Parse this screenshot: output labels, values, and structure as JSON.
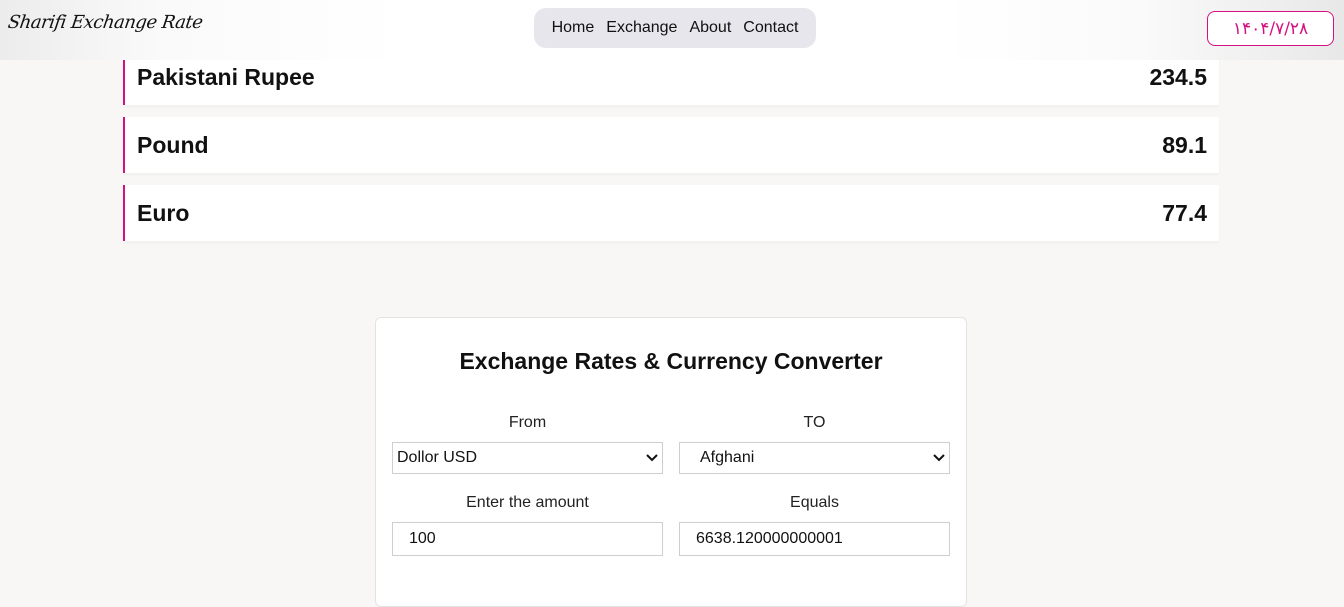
{
  "header": {
    "logo": "Sharifi Exchange Rate",
    "nav": [
      "Home",
      "Exchange",
      "About",
      "Contact"
    ],
    "date": "۱۴۰۴/۷/۲۸"
  },
  "rates": [
    {
      "name": "Pakistani Rupee",
      "value": "234.5"
    },
    {
      "name": "Pound",
      "value": "89.1"
    },
    {
      "name": "Euro",
      "value": "77.4"
    }
  ],
  "converter": {
    "title": "Exchange Rates & Currency Converter",
    "from_label": "From",
    "to_label": "TO",
    "from_value": "Dollor USD",
    "to_value": "Afghani",
    "amount_label": "Enter the amount",
    "equals_label": "Equals",
    "amount_value": "100",
    "equals_value": "6638.120000000001"
  },
  "colors": {
    "accent": "#d6117f"
  },
  "icons": {
    "select_arrow": "chevron-down-icon"
  }
}
